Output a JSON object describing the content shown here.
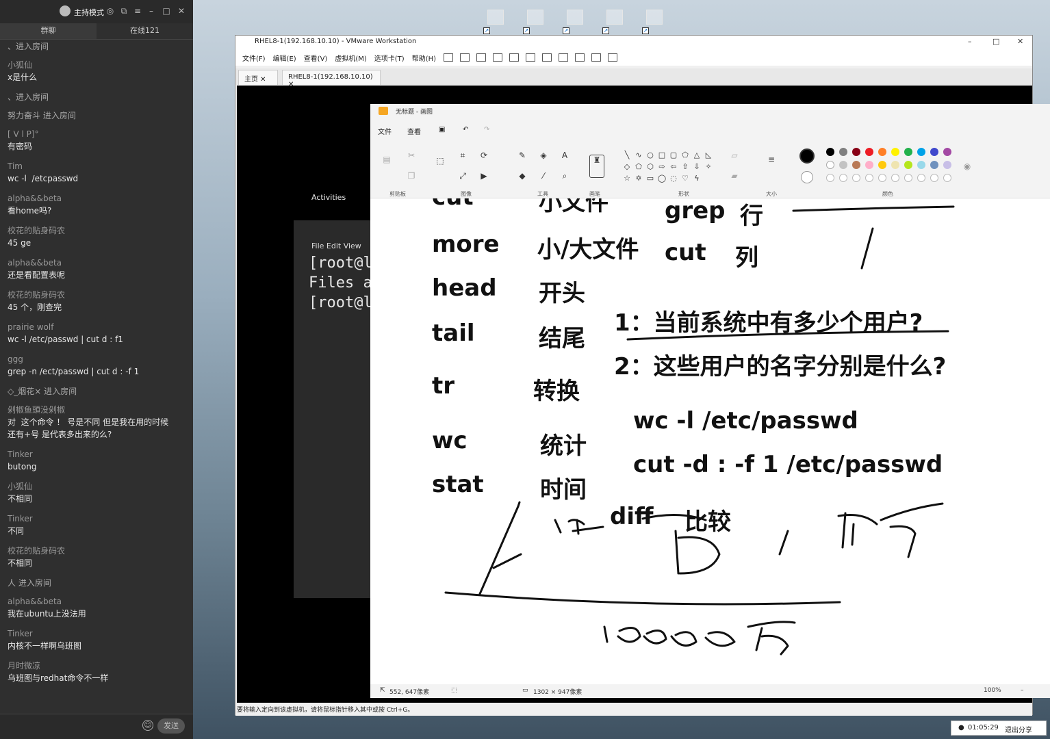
{
  "chat": {
    "mode_label": "主持模式",
    "tabs": [
      "群聊",
      "在线121"
    ],
    "messages": [
      {
        "name": "、进入房间",
        "text": "",
        "sys": true
      },
      {
        "name": "小狐仙",
        "text": "x是什么"
      },
      {
        "name": "、进入房间",
        "text": "",
        "sys": true
      },
      {
        "name": "努力奋斗 进入房间",
        "text": "",
        "sys": true
      },
      {
        "name": "[ V l P]°",
        "text": "有密码"
      },
      {
        "name": "Tim",
        "text": "wc -l  /etcpasswd"
      },
      {
        "name": "alpha&&beta",
        "text": "看home吗?"
      },
      {
        "name": "校花的贴身码农",
        "text": "45 ge"
      },
      {
        "name": "alpha&&beta",
        "text": "还是看配置表呢"
      },
      {
        "name": "校花的贴身码农",
        "text": "45 个，刚查完"
      },
      {
        "name": "prairie wolf",
        "text": "wc -l /etc/passwd | cut d : f1"
      },
      {
        "name": "ggg",
        "text": "grep -n /ect/passwd | cut d : -f 1"
      },
      {
        "name": "◇_烟花×     进入房间",
        "text": "",
        "sys": true
      },
      {
        "name": "剁椒鱼頭没剁椒",
        "text": "对  这个命令 ！ 号是不同 但是我在用的时候\n还有+号 是代表多出来的么?"
      },
      {
        "name": "Tinker",
        "text": "butong"
      },
      {
        "name": "小狐仙",
        "text": "不相同"
      },
      {
        "name": "Tinker",
        "text": "不同"
      },
      {
        "name": "校花的贴身码农",
        "text": "不相同"
      },
      {
        "name": "人 进入房间",
        "text": "",
        "sys": true
      },
      {
        "name": "alpha&&beta",
        "text": "我在ubuntu上没法用"
      },
      {
        "name": "Tinker",
        "text": "内核不一样啊乌班图"
      },
      {
        "name": "月时微凉",
        "text": "乌班图与redhat命令不一样"
      }
    ],
    "send_label": "发送",
    "emoji_icon": "smiley-icon"
  },
  "vmware": {
    "title": "RHEL8-1(192.168.10.10) - VMware Workstation",
    "menu": [
      "文件(F)",
      "编辑(E)",
      "查看(V)",
      "虚拟机(M)",
      "选项卡(T)",
      "帮助(H)"
    ],
    "tabs": [
      "主页",
      "RHEL8-1(192.168.10.10)"
    ],
    "status": "要将输入定向到该虚拟机，请将鼠标指针移入其中或按 Ctrl+G。"
  },
  "guest": {
    "activities": "Activities",
    "terminal_menu": "File   Edit   View",
    "terminal_lines": [
      "[root@l",
      "Files a",
      "[root@l"
    ]
  },
  "paint": {
    "title": "无标题 - 画图",
    "menu": [
      "文件",
      "查看"
    ],
    "groups": [
      "剪贴板",
      "图像",
      "工具",
      "画笔",
      "形状",
      "大小",
      "颜色"
    ],
    "commands": [
      {
        "cmd": "cut",
        "zh": "小文件"
      },
      {
        "cmd": "more",
        "zh": "小/大文件"
      },
      {
        "cmd": "head",
        "zh": "开头"
      },
      {
        "cmd": "tail",
        "zh": "结尾"
      },
      {
        "cmd": "tr",
        "zh": "转换"
      },
      {
        "cmd": "wc",
        "zh": "统计"
      },
      {
        "cmd": "stat",
        "zh": "时间"
      }
    ],
    "grep_cmd": "grep",
    "grep_zh": "行",
    "cut_cmd": "cut",
    "cut_zh": "列",
    "q1": "1：当前系统中有多少个用户?",
    "q2": "2：这些用户的名字分别是什么?",
    "ans1": "wc -l /etc/passwd",
    "ans2": "cut -d : -f 1 /etc/passwd",
    "diff_cmd": "diff",
    "diff_zh": "比较",
    "status_pos": "552, 647像素",
    "status_size": "1302 × 947像素",
    "zoom": "100%",
    "palette": [
      "#000000",
      "#7f7f7f",
      "#880015",
      "#ed1c24",
      "#ff7f27",
      "#fff200",
      "#22b14c",
      "#00a2e8",
      "#3f48cc",
      "#a349a4",
      "#ffffff",
      "#c3c3c3",
      "#b97a57",
      "#ffaec9",
      "#ffc90e",
      "#efe4b0",
      "#b5e61d",
      "#99d9ea",
      "#7092be",
      "#c8bfe7"
    ]
  },
  "tray": {
    "time": "01:05:29",
    "share": "退出分享"
  }
}
